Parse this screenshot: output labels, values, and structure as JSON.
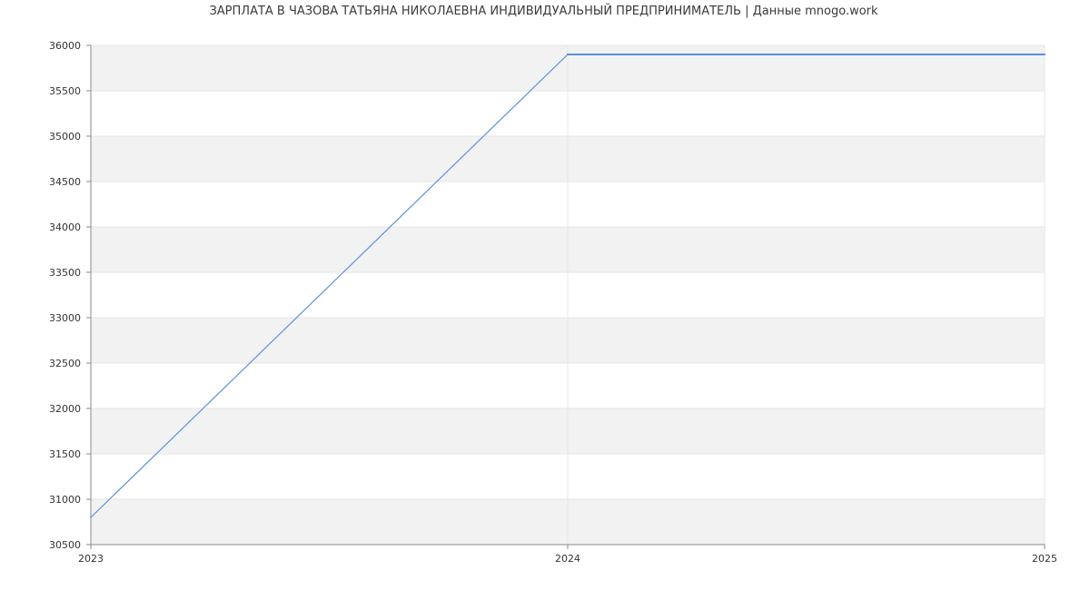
{
  "chart_data": {
    "type": "line",
    "title": "ЗАРПЛАТА В ЧАЗОВА ТАТЬЯНА НИКОЛАЕВНА ИНДИВИДУАЛЬНЫЙ ПРЕДПРИНИМАТЕЛЬ | Данные mnogo.work",
    "xlabel": "",
    "ylabel": "",
    "x_ticks": [
      "2023",
      "2024",
      "2025"
    ],
    "y_ticks": [
      "30500",
      "31000",
      "31500",
      "32000",
      "32500",
      "33000",
      "33500",
      "34000",
      "34500",
      "35000",
      "35500",
      "36000"
    ],
    "xlim": [
      2023,
      2025
    ],
    "ylim": [
      30500,
      36000
    ],
    "grid": true,
    "legend": "none",
    "series": [
      {
        "x": [
          2023,
          2024,
          2025
        ],
        "y": [
          30800,
          35900,
          35900
        ],
        "color": "#5b8fe0"
      }
    ],
    "colors": {
      "band": "#f2f2f2",
      "gridline": "#e6e6e6",
      "axis": "#888888",
      "series_line": "#5b8fe0"
    }
  }
}
